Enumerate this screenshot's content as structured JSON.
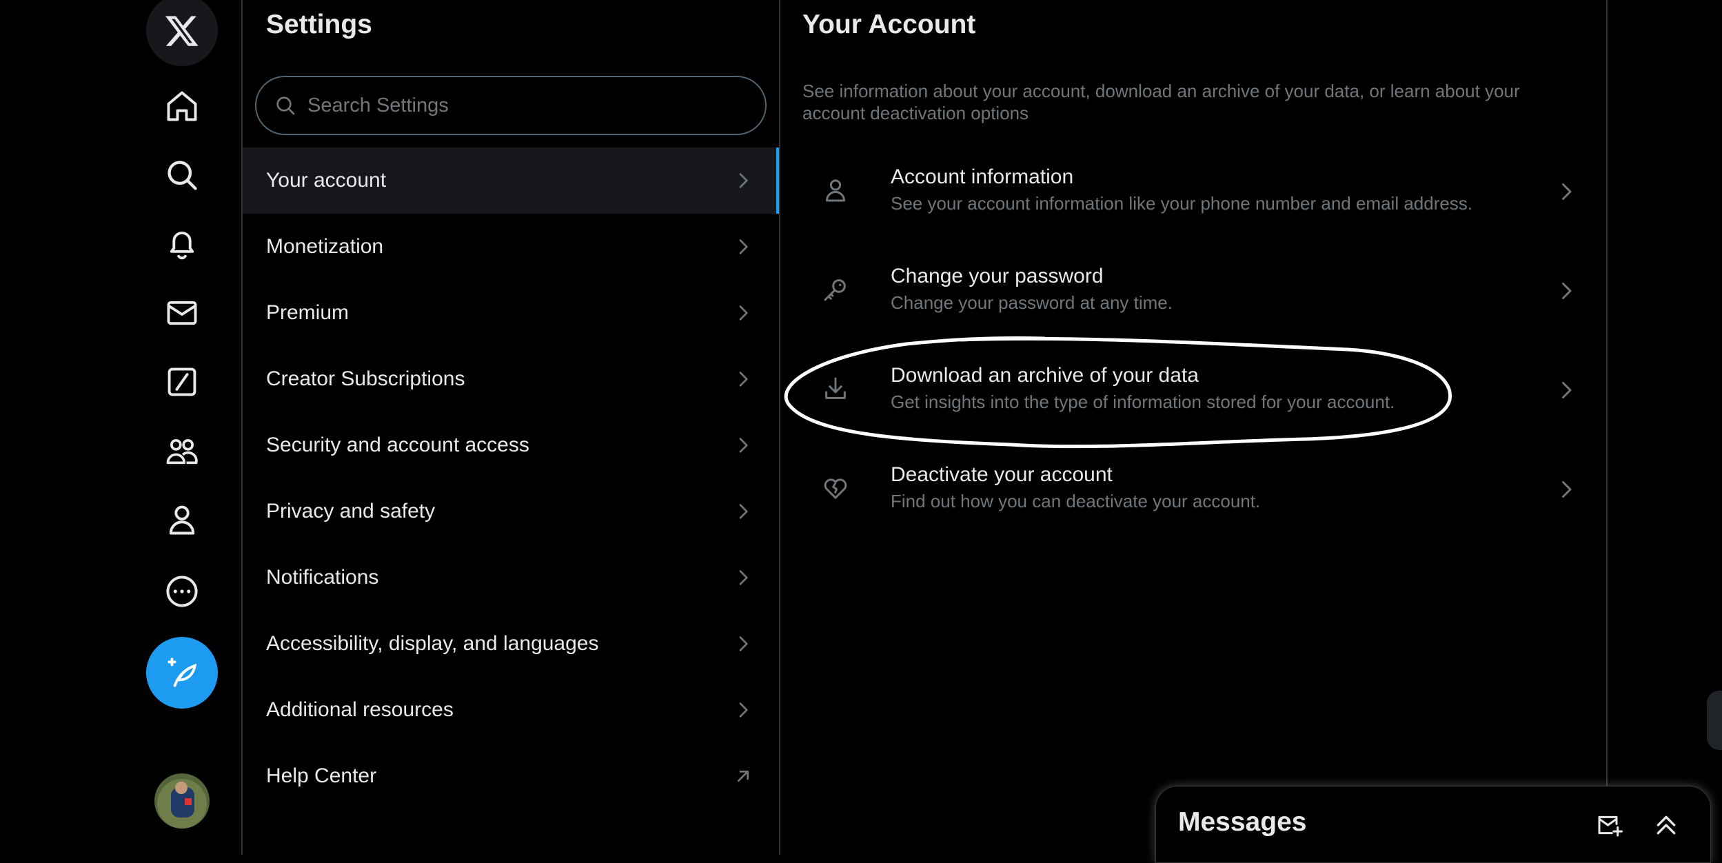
{
  "nav": {
    "items": [
      {
        "name": "x-logo-icon"
      },
      {
        "name": "home-icon"
      },
      {
        "name": "explore-search-icon"
      },
      {
        "name": "notifications-bell-icon"
      },
      {
        "name": "messages-envelope-icon"
      },
      {
        "name": "grok-icon"
      },
      {
        "name": "communities-icon"
      },
      {
        "name": "profile-icon"
      },
      {
        "name": "more-icon"
      }
    ],
    "post_button_icon": "compose-feather-icon",
    "accent_color": "#1d9bf0"
  },
  "settings": {
    "title": "Settings",
    "search_placeholder": "Search Settings",
    "items": [
      {
        "label": "Your account",
        "active": true,
        "icon": "chevron-right-icon"
      },
      {
        "label": "Monetization",
        "icon": "chevron-right-icon"
      },
      {
        "label": "Premium",
        "icon": "chevron-right-icon"
      },
      {
        "label": "Creator Subscriptions",
        "icon": "chevron-right-icon"
      },
      {
        "label": "Security and account access",
        "icon": "chevron-right-icon"
      },
      {
        "label": "Privacy and safety",
        "icon": "chevron-right-icon"
      },
      {
        "label": "Notifications",
        "icon": "chevron-right-icon"
      },
      {
        "label": "Accessibility, display, and languages",
        "icon": "chevron-right-icon"
      },
      {
        "label": "Additional resources",
        "icon": "chevron-right-icon"
      },
      {
        "label": "Help Center",
        "icon": "external-arrow-icon"
      }
    ]
  },
  "account": {
    "title": "Your Account",
    "description": "See information about your account, download an archive of your data, or learn about your account deactivation options",
    "options": [
      {
        "title": "Account information",
        "subtitle": "See your account information like your phone number and email address.",
        "icon": "person-icon"
      },
      {
        "title": "Change your password",
        "subtitle": "Change your password at any time.",
        "icon": "key-icon"
      },
      {
        "title": "Download an archive of your data",
        "subtitle": "Get insights into the type of information stored for your account.",
        "icon": "download-icon",
        "circled": true
      },
      {
        "title": "Deactivate your account",
        "subtitle": "Find out how you can deactivate your account.",
        "icon": "broken-heart-icon"
      }
    ]
  },
  "messages_drawer": {
    "title": "Messages",
    "icons": [
      "new-message-icon",
      "expand-up-icon"
    ]
  }
}
